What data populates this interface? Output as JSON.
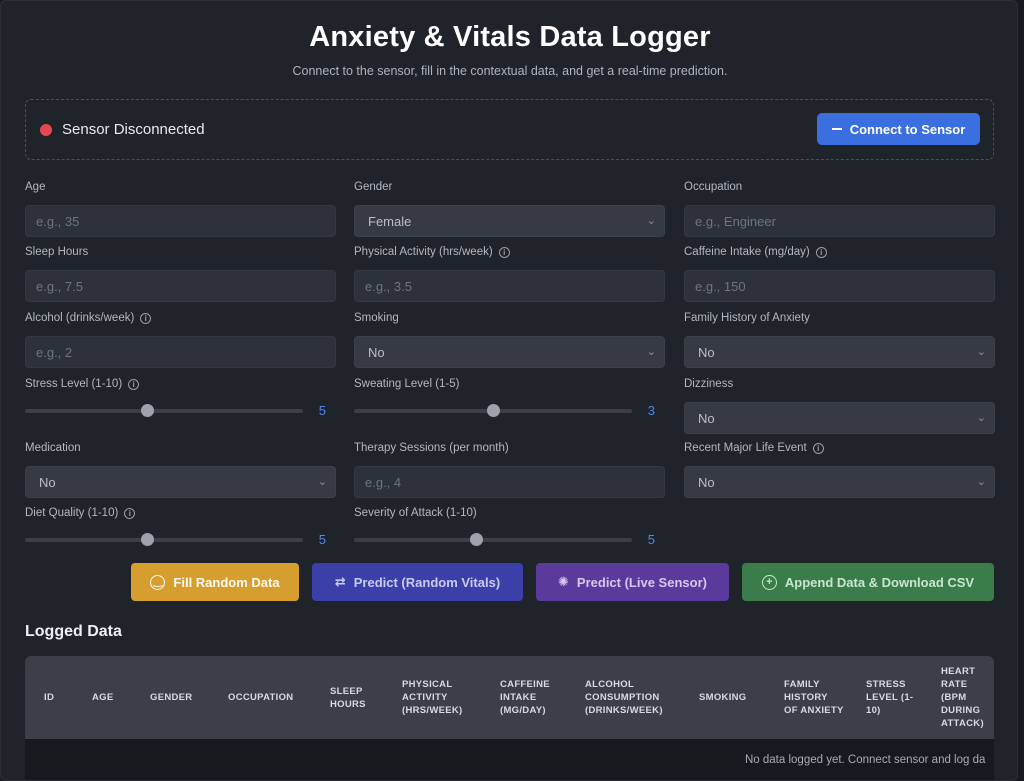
{
  "header": {
    "title": "Anxiety & Vitals Data Logger",
    "subtitle": "Connect to the sensor, fill in the contextual data, and get a real-time prediction."
  },
  "sensor": {
    "status": "Sensor Disconnected",
    "status_color": "#e5484d",
    "connect_label": "Connect to Sensor"
  },
  "form": {
    "age": {
      "label": "Age",
      "placeholder": "e.g., 35"
    },
    "gender": {
      "label": "Gender",
      "value": "Female"
    },
    "occupation": {
      "label": "Occupation",
      "placeholder": "e.g., Engineer"
    },
    "sleep_hours": {
      "label": "Sleep Hours",
      "placeholder": "e.g., 7.5"
    },
    "physical_activity": {
      "label": "Physical Activity (hrs/week)",
      "placeholder": "e.g., 3.5"
    },
    "caffeine": {
      "label": "Caffeine Intake (mg/day)",
      "placeholder": "e.g., 150"
    },
    "alcohol": {
      "label": "Alcohol (drinks/week)",
      "placeholder": "e.g., 2"
    },
    "smoking": {
      "label": "Smoking",
      "value": "No"
    },
    "family_history": {
      "label": "Family History of Anxiety",
      "value": "No"
    },
    "stress_level": {
      "label": "Stress Level (1-10)",
      "value": "5",
      "fraction": 0.44
    },
    "sweating_level": {
      "label": "Sweating Level (1-5)",
      "value": "3",
      "fraction": 0.5
    },
    "dizziness": {
      "label": "Dizziness",
      "value": "No"
    },
    "medication": {
      "label": "Medication",
      "value": "No"
    },
    "therapy": {
      "label": "Therapy Sessions (per month)",
      "placeholder": "e.g., 4"
    },
    "life_event": {
      "label": "Recent Major Life Event",
      "value": "No"
    },
    "diet_quality": {
      "label": "Diet Quality (1-10)",
      "value": "5",
      "fraction": 0.44
    },
    "severity": {
      "label": "Severity of Attack (1-10)",
      "value": "5",
      "fraction": 0.44
    }
  },
  "actions": {
    "fill_random": "Fill Random Data",
    "predict_random": "Predict (Random Vitals)",
    "predict_live": "Predict (Live Sensor)",
    "append_download": "Append Data & Download CSV"
  },
  "logged": {
    "title": "Logged Data",
    "columns": [
      "ID",
      "AGE",
      "GENDER",
      "OCCUPATION",
      "SLEEP HOURS",
      "PHYSICAL ACTIVITY (HRS/WEEK)",
      "CAFFEINE INTAKE (MG/DAY)",
      "ALCOHOL CONSUMPTION (DRINKS/WEEK)",
      "SMOKING",
      "FAMILY HISTORY OF ANXIETY",
      "STRESS LEVEL (1-10)",
      "HEART RATE (BPM DURING ATTACK)"
    ],
    "empty_message": "No data logged yet. Connect sensor and log da"
  },
  "colors": {
    "accent_blue": "#3b6fe0",
    "fill_button": "#d69e2e",
    "predict_random_button": "#3b3fa8",
    "predict_live_button": "#5a3a9a",
    "append_button": "#3a7d4a"
  }
}
